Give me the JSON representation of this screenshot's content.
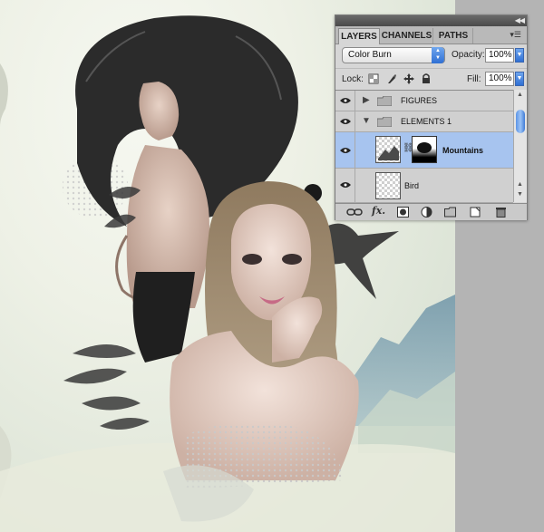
{
  "panel": {
    "collapse_icon": "double-arrow-icon",
    "tabs": [
      {
        "label": "LAYERS",
        "active": true
      },
      {
        "label": "CHANNELS",
        "active": false
      },
      {
        "label": "PATHS",
        "active": false
      }
    ],
    "menu_icon": "panel-menu-icon",
    "blend_mode": "Color Burn",
    "opacity_label": "Opacity:",
    "opacity_value": "100%",
    "lock_label": "Lock:",
    "fill_label": "Fill:",
    "fill_value": "100%",
    "layers": [
      {
        "name": "FIGURES",
        "type": "group",
        "expanded": false,
        "visible": true
      },
      {
        "name": "ELEMENTS 1",
        "type": "group",
        "expanded": true,
        "visible": true
      },
      {
        "name": "Mountains",
        "type": "layer",
        "selected": true,
        "visible": true,
        "has_mask": true
      },
      {
        "name": "Bird",
        "type": "layer",
        "selected": false,
        "visible": true
      }
    ],
    "toolbar_icons": [
      "link-icon",
      "fx-icon",
      "mask-icon",
      "adjustment-icon",
      "folder-icon",
      "new-layer-icon",
      "trash-icon"
    ]
  },
  "colors": {
    "selected_row": "#a7c4ef",
    "accent_blue": "#2f6fd4",
    "canvas_bg": "#eef1e6",
    "workspace_gray": "#b3b3b3"
  }
}
